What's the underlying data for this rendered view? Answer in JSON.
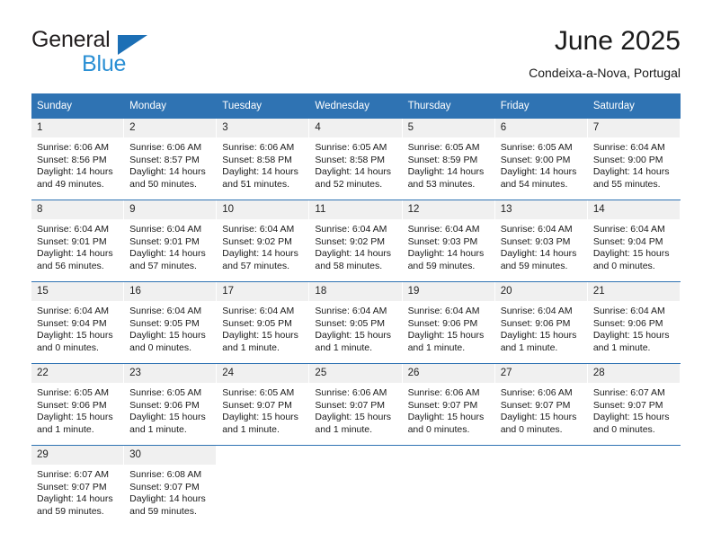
{
  "brand": {
    "word_one": "General",
    "word_two": "Blue",
    "triangle_icon": "blue-triangle-icon"
  },
  "header": {
    "title": "June 2025",
    "subtitle": "Condeixa-a-Nova, Portugal"
  },
  "calendar": {
    "weekday_headers": [
      "Sunday",
      "Monday",
      "Tuesday",
      "Wednesday",
      "Thursday",
      "Friday",
      "Saturday"
    ],
    "accent_color": "#2f73b3",
    "daynum_background": "#f0f0f0",
    "weeks": [
      [
        {
          "day": "1",
          "sunrise": "Sunrise: 6:06 AM",
          "sunset": "Sunset: 8:56 PM",
          "daylight_line1": "Daylight: 14 hours",
          "daylight_line2": "and 49 minutes."
        },
        {
          "day": "2",
          "sunrise": "Sunrise: 6:06 AM",
          "sunset": "Sunset: 8:57 PM",
          "daylight_line1": "Daylight: 14 hours",
          "daylight_line2": "and 50 minutes."
        },
        {
          "day": "3",
          "sunrise": "Sunrise: 6:06 AM",
          "sunset": "Sunset: 8:58 PM",
          "daylight_line1": "Daylight: 14 hours",
          "daylight_line2": "and 51 minutes."
        },
        {
          "day": "4",
          "sunrise": "Sunrise: 6:05 AM",
          "sunset": "Sunset: 8:58 PM",
          "daylight_line1": "Daylight: 14 hours",
          "daylight_line2": "and 52 minutes."
        },
        {
          "day": "5",
          "sunrise": "Sunrise: 6:05 AM",
          "sunset": "Sunset: 8:59 PM",
          "daylight_line1": "Daylight: 14 hours",
          "daylight_line2": "and 53 minutes."
        },
        {
          "day": "6",
          "sunrise": "Sunrise: 6:05 AM",
          "sunset": "Sunset: 9:00 PM",
          "daylight_line1": "Daylight: 14 hours",
          "daylight_line2": "and 54 minutes."
        },
        {
          "day": "7",
          "sunrise": "Sunrise: 6:04 AM",
          "sunset": "Sunset: 9:00 PM",
          "daylight_line1": "Daylight: 14 hours",
          "daylight_line2": "and 55 minutes."
        }
      ],
      [
        {
          "day": "8",
          "sunrise": "Sunrise: 6:04 AM",
          "sunset": "Sunset: 9:01 PM",
          "daylight_line1": "Daylight: 14 hours",
          "daylight_line2": "and 56 minutes."
        },
        {
          "day": "9",
          "sunrise": "Sunrise: 6:04 AM",
          "sunset": "Sunset: 9:01 PM",
          "daylight_line1": "Daylight: 14 hours",
          "daylight_line2": "and 57 minutes."
        },
        {
          "day": "10",
          "sunrise": "Sunrise: 6:04 AM",
          "sunset": "Sunset: 9:02 PM",
          "daylight_line1": "Daylight: 14 hours",
          "daylight_line2": "and 57 minutes."
        },
        {
          "day": "11",
          "sunrise": "Sunrise: 6:04 AM",
          "sunset": "Sunset: 9:02 PM",
          "daylight_line1": "Daylight: 14 hours",
          "daylight_line2": "and 58 minutes."
        },
        {
          "day": "12",
          "sunrise": "Sunrise: 6:04 AM",
          "sunset": "Sunset: 9:03 PM",
          "daylight_line1": "Daylight: 14 hours",
          "daylight_line2": "and 59 minutes."
        },
        {
          "day": "13",
          "sunrise": "Sunrise: 6:04 AM",
          "sunset": "Sunset: 9:03 PM",
          "daylight_line1": "Daylight: 14 hours",
          "daylight_line2": "and 59 minutes."
        },
        {
          "day": "14",
          "sunrise": "Sunrise: 6:04 AM",
          "sunset": "Sunset: 9:04 PM",
          "daylight_line1": "Daylight: 15 hours",
          "daylight_line2": "and 0 minutes."
        }
      ],
      [
        {
          "day": "15",
          "sunrise": "Sunrise: 6:04 AM",
          "sunset": "Sunset: 9:04 PM",
          "daylight_line1": "Daylight: 15 hours",
          "daylight_line2": "and 0 minutes."
        },
        {
          "day": "16",
          "sunrise": "Sunrise: 6:04 AM",
          "sunset": "Sunset: 9:05 PM",
          "daylight_line1": "Daylight: 15 hours",
          "daylight_line2": "and 0 minutes."
        },
        {
          "day": "17",
          "sunrise": "Sunrise: 6:04 AM",
          "sunset": "Sunset: 9:05 PM",
          "daylight_line1": "Daylight: 15 hours",
          "daylight_line2": "and 1 minute."
        },
        {
          "day": "18",
          "sunrise": "Sunrise: 6:04 AM",
          "sunset": "Sunset: 9:05 PM",
          "daylight_line1": "Daylight: 15 hours",
          "daylight_line2": "and 1 minute."
        },
        {
          "day": "19",
          "sunrise": "Sunrise: 6:04 AM",
          "sunset": "Sunset: 9:06 PM",
          "daylight_line1": "Daylight: 15 hours",
          "daylight_line2": "and 1 minute."
        },
        {
          "day": "20",
          "sunrise": "Sunrise: 6:04 AM",
          "sunset": "Sunset: 9:06 PM",
          "daylight_line1": "Daylight: 15 hours",
          "daylight_line2": "and 1 minute."
        },
        {
          "day": "21",
          "sunrise": "Sunrise: 6:04 AM",
          "sunset": "Sunset: 9:06 PM",
          "daylight_line1": "Daylight: 15 hours",
          "daylight_line2": "and 1 minute."
        }
      ],
      [
        {
          "day": "22",
          "sunrise": "Sunrise: 6:05 AM",
          "sunset": "Sunset: 9:06 PM",
          "daylight_line1": "Daylight: 15 hours",
          "daylight_line2": "and 1 minute."
        },
        {
          "day": "23",
          "sunrise": "Sunrise: 6:05 AM",
          "sunset": "Sunset: 9:06 PM",
          "daylight_line1": "Daylight: 15 hours",
          "daylight_line2": "and 1 minute."
        },
        {
          "day": "24",
          "sunrise": "Sunrise: 6:05 AM",
          "sunset": "Sunset: 9:07 PM",
          "daylight_line1": "Daylight: 15 hours",
          "daylight_line2": "and 1 minute."
        },
        {
          "day": "25",
          "sunrise": "Sunrise: 6:06 AM",
          "sunset": "Sunset: 9:07 PM",
          "daylight_line1": "Daylight: 15 hours",
          "daylight_line2": "and 1 minute."
        },
        {
          "day": "26",
          "sunrise": "Sunrise: 6:06 AM",
          "sunset": "Sunset: 9:07 PM",
          "daylight_line1": "Daylight: 15 hours",
          "daylight_line2": "and 0 minutes."
        },
        {
          "day": "27",
          "sunrise": "Sunrise: 6:06 AM",
          "sunset": "Sunset: 9:07 PM",
          "daylight_line1": "Daylight: 15 hours",
          "daylight_line2": "and 0 minutes."
        },
        {
          "day": "28",
          "sunrise": "Sunrise: 6:07 AM",
          "sunset": "Sunset: 9:07 PM",
          "daylight_line1": "Daylight: 15 hours",
          "daylight_line2": "and 0 minutes."
        }
      ],
      [
        {
          "day": "29",
          "sunrise": "Sunrise: 6:07 AM",
          "sunset": "Sunset: 9:07 PM",
          "daylight_line1": "Daylight: 14 hours",
          "daylight_line2": "and 59 minutes."
        },
        {
          "day": "30",
          "sunrise": "Sunrise: 6:08 AM",
          "sunset": "Sunset: 9:07 PM",
          "daylight_line1": "Daylight: 14 hours",
          "daylight_line2": "and 59 minutes."
        },
        {
          "day": "",
          "sunrise": "",
          "sunset": "",
          "daylight_line1": "",
          "daylight_line2": ""
        },
        {
          "day": "",
          "sunrise": "",
          "sunset": "",
          "daylight_line1": "",
          "daylight_line2": ""
        },
        {
          "day": "",
          "sunrise": "",
          "sunset": "",
          "daylight_line1": "",
          "daylight_line2": ""
        },
        {
          "day": "",
          "sunrise": "",
          "sunset": "",
          "daylight_line1": "",
          "daylight_line2": ""
        },
        {
          "day": "",
          "sunrise": "",
          "sunset": "",
          "daylight_line1": "",
          "daylight_line2": ""
        }
      ]
    ]
  }
}
